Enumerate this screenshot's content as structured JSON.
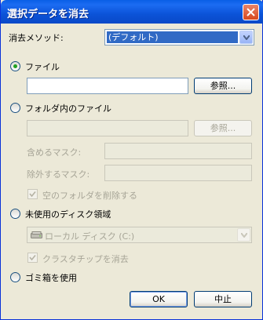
{
  "window": {
    "title": "選択データを消去"
  },
  "method": {
    "label": "消去メソッド:",
    "selected": "(デフォルト)"
  },
  "file_option": {
    "label": "ファイル",
    "path_value": "",
    "browse_label": "参照..."
  },
  "folder_option": {
    "label": "フォルダ内のファイル",
    "path_value": "",
    "browse_label": "参照...",
    "include_mask_label": "含めるマスク:",
    "include_mask_value": "",
    "exclude_mask_label": "除外するマスク:",
    "exclude_mask_value": "",
    "delete_empty_label": "空のフォルダを削除する"
  },
  "free_space_option": {
    "label": "未使用のディスク領域",
    "drive_selected": "ローカル ディスク (C:)",
    "cluster_tips_label": "クラスタチップを消去"
  },
  "recycle_option": {
    "label": "ゴミ箱を使用"
  },
  "footer": {
    "ok_label": "OK",
    "cancel_label": "中止"
  },
  "colors": {
    "titlebar": "#0a5fe6",
    "selection": "#316ac5",
    "radio_dot": "#21a121",
    "disabled_text": "#a7a597"
  },
  "icons": [
    "close-icon",
    "dropdown-arrow-icon",
    "drive-icon",
    "checkmark-icon"
  ]
}
